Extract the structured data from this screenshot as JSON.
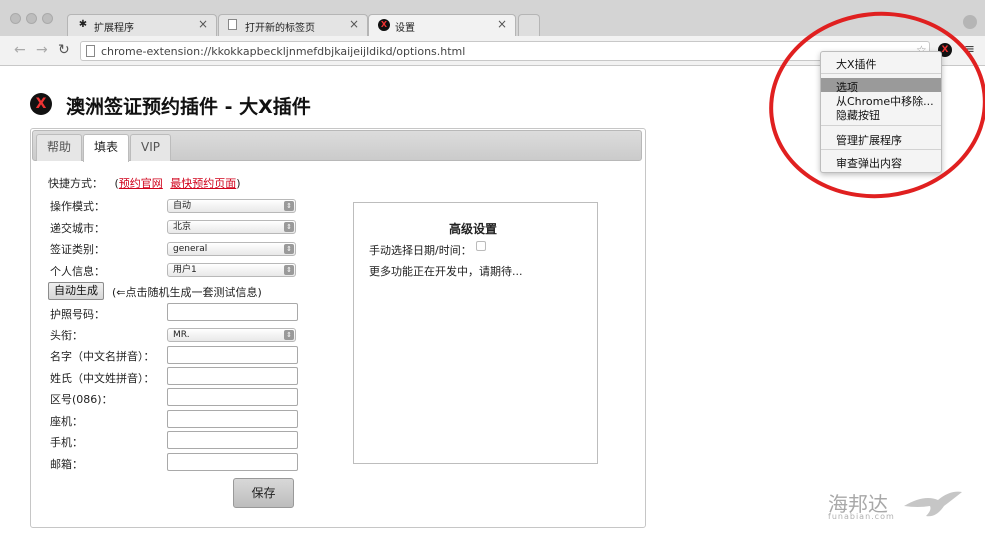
{
  "browser": {
    "tabs": [
      {
        "title": "扩展程序",
        "icon": "puzzle-icon"
      },
      {
        "title": "打开新的标签页",
        "icon": "page-icon"
      },
      {
        "title": "设置",
        "icon": "x-logo-icon"
      }
    ],
    "url": "chrome-extension://kkokkapbeckljnmefdbjkaijeijldikd/options.html"
  },
  "page": {
    "logo_letter": "X",
    "title": "澳洲签证预约插件 - 大X插件"
  },
  "panel_tabs": [
    "帮助",
    "填表",
    "VIP"
  ],
  "form": {
    "shortcut_label": "快捷方式：",
    "shortcut_open": "(",
    "shortcut_link1": "预约官网",
    "shortcut_link2": "最快预约页面",
    "shortcut_close": ")",
    "mode_label": "操作模式：",
    "mode_value": "自动",
    "city_label": "递交城市：",
    "city_value": "北京",
    "visa_label": "签证类别：",
    "visa_value": "general",
    "personal_label": "个人信息：",
    "personal_value": "用户1",
    "generate_button": "自动生成",
    "generate_hint": "(⇐点击随机生成一套测试信息)",
    "passport_label": "护照号码：",
    "title_label": "头衔：",
    "title_value": "MR.",
    "firstname_label": "名字（中文名拼音）：",
    "lastname_label": "姓氏（中文姓拼音）：",
    "areacode_label": "区号(086)：",
    "landline_label": "座机：",
    "mobile_label": "手机：",
    "email_label": "邮箱：",
    "save_button": "保存"
  },
  "advanced": {
    "title": "高级设置",
    "manual_label": "手动选择日期/时间：",
    "note": "更多功能正在开发中，请期待..."
  },
  "menu": {
    "items": [
      "大X插件",
      "选项",
      "从Chrome中移除...",
      "隐藏按钮",
      "管理扩展程序",
      "审查弹出内容"
    ]
  },
  "watermark": {
    "main": "海邦达",
    "sub": "funabian.com"
  }
}
